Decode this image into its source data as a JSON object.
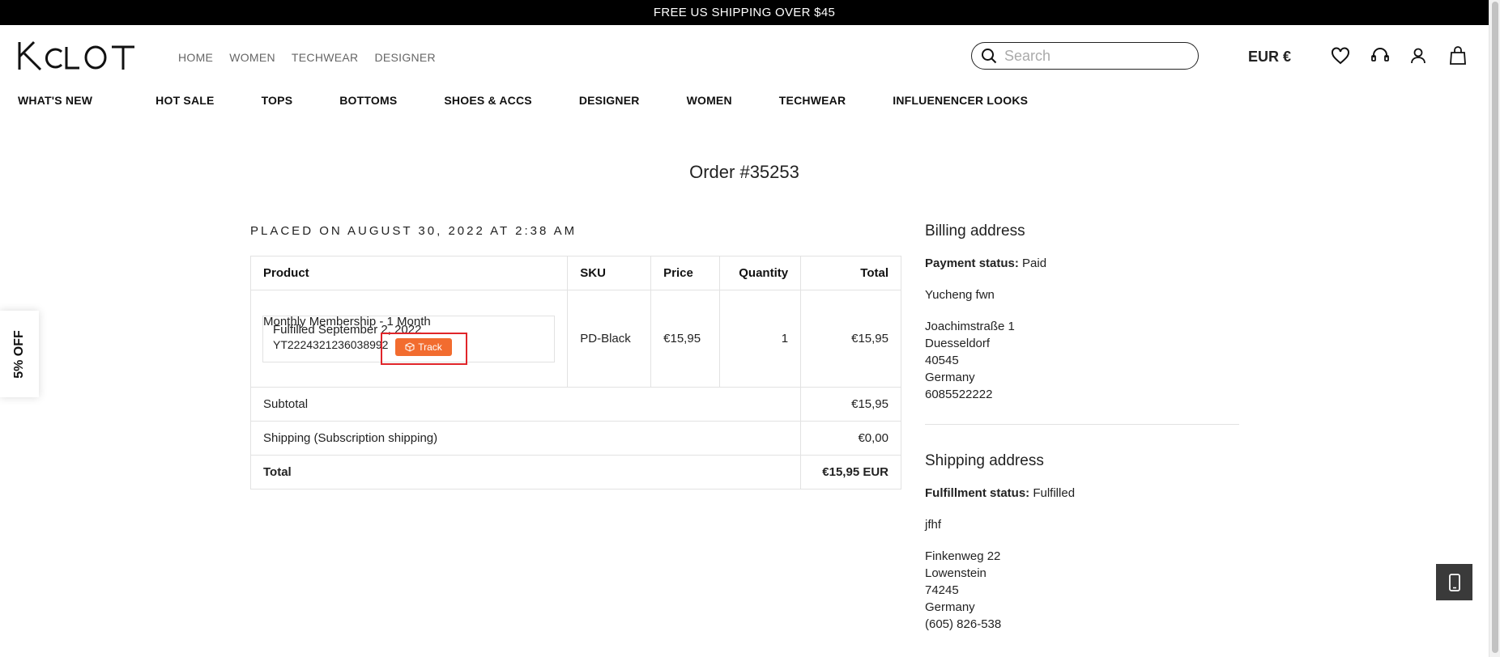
{
  "announcement": "FREE US SHIPPING OVER $45",
  "logo_text": "KCLOT",
  "top_nav": [
    "HOME",
    "WOMEN",
    "TECHWEAR",
    "DESIGNER"
  ],
  "search": {
    "placeholder": "Search",
    "value": ""
  },
  "currency": "EUR €",
  "header_icons": [
    "heart-icon",
    "headset-icon",
    "user-icon",
    "bag-icon"
  ],
  "main_nav": [
    "WHAT'S NEW",
    "HOT SALE",
    "TOPS",
    "BOTTOMS",
    "SHOES & ACCS",
    "DESIGNER",
    "WOMEN",
    "TECHWEAR",
    "INFLUENENCER LOOKS"
  ],
  "promo_tab": "5% OFF",
  "order": {
    "title": "Order #35253",
    "placed": "PLACED ON AUGUST 30, 2022 AT 2:38 AM",
    "columns": {
      "product": "Product",
      "sku": "SKU",
      "price": "Price",
      "quantity": "Quantity",
      "total": "Total"
    },
    "item": {
      "name": "Monthly Membership - 1 Month",
      "fulfilled": "Fulfilled September 2, 2022",
      "tracking": "YT2224321236038992",
      "track_label": "Track",
      "sku": "PD-Black",
      "price": "€15,95",
      "quantity": "1",
      "total": "€15,95"
    },
    "subtotal_label": "Subtotal",
    "subtotal": "€15,95",
    "shipping_label": "Shipping (Subscription shipping)",
    "shipping": "€0,00",
    "total_label": "Total",
    "total": "€15,95 EUR"
  },
  "billing": {
    "heading": "Billing address",
    "status_label": "Payment status:",
    "status": "Paid",
    "name": "Yucheng fwn",
    "street": "Joachimstraße 1",
    "city": "Duesseldorf",
    "zip": "40545",
    "country": "Germany",
    "phone": "6085522222"
  },
  "shipping_address": {
    "heading": "Shipping address",
    "status_label": "Fulfillment status:",
    "status": "Fulfilled",
    "name": "jfhf",
    "street": "Finkenweg 22",
    "city": "Lowenstein",
    "zip": "74245",
    "country": "Germany",
    "phone": "(605) 826-538"
  },
  "colors": {
    "accent": "#f26c2f",
    "highlight": "#e0252a",
    "announcement_bg": "#000000"
  }
}
